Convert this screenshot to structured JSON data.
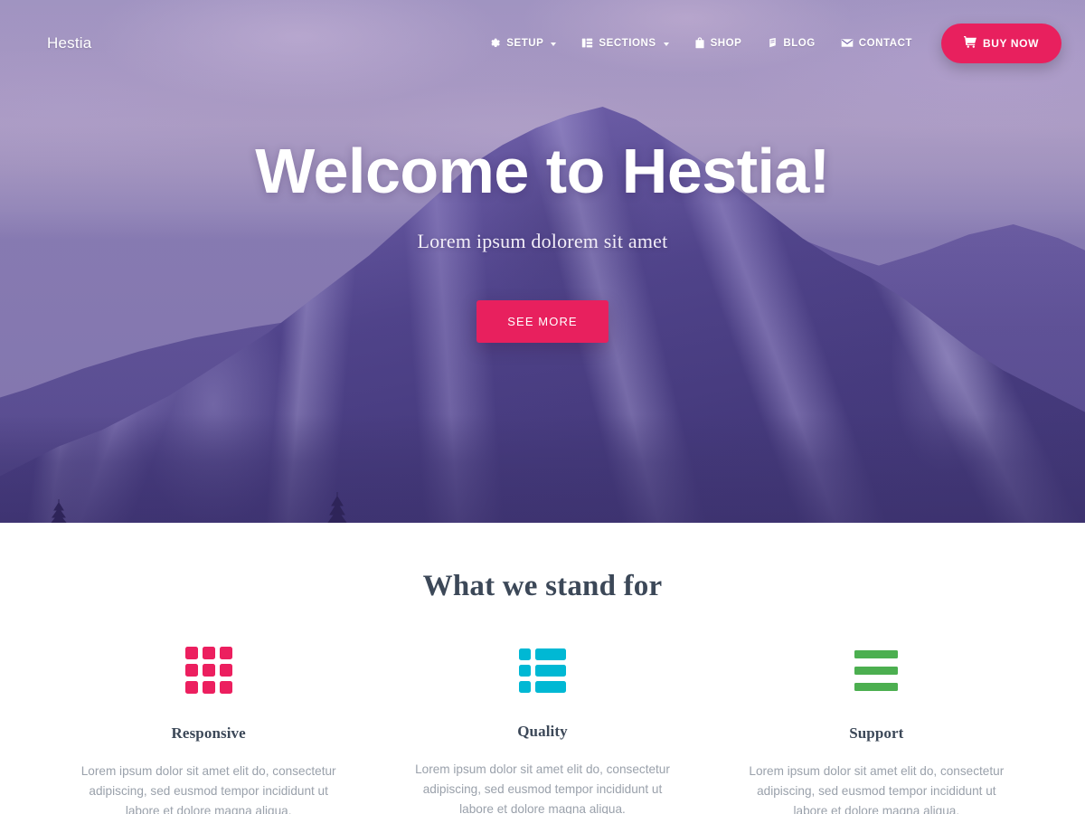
{
  "navbar": {
    "brand": "Hestia",
    "items": [
      {
        "label": "SETUP",
        "icon": "gear-icon",
        "has_caret": true
      },
      {
        "label": "SECTIONS",
        "icon": "sections-icon",
        "has_caret": true
      },
      {
        "label": "SHOP",
        "icon": "shopping-bag-icon",
        "has_caret": false
      },
      {
        "label": "BLOG",
        "icon": "pencil-icon",
        "has_caret": false
      },
      {
        "label": "CONTACT",
        "icon": "envelope-icon",
        "has_caret": false
      }
    ],
    "buy_now": {
      "label": "BUY NOW",
      "icon": "shopping-cart-icon"
    }
  },
  "hero": {
    "title": "Welcome to Hestia!",
    "subtitle": "Lorem ipsum dolorem sit amet",
    "cta_label": "SEE MORE"
  },
  "features": {
    "title": "What we stand for",
    "items": [
      {
        "icon": "grid-icon",
        "color": "#ec1f5f",
        "title": "Responsive",
        "text": "Lorem ipsum dolor sit amet elit do, consectetur adipiscing, sed eusmod tempor incididunt ut labore et dolore magna aliqua."
      },
      {
        "icon": "list-icon",
        "color": "#00b8d4",
        "title": "Quality",
        "text": "Lorem ipsum dolor sit amet elit do, consectetur adipiscing, sed eusmod tempor incididunt ut labore et dolore magna aliqua."
      },
      {
        "icon": "bars-icon",
        "color": "#4caf50",
        "title": "Support",
        "text": "Lorem ipsum dolor sit amet elit do, consectetur adipiscing, sed eusmod tempor incididunt ut labore et dolore magna aliqua."
      }
    ]
  },
  "colors": {
    "accent_pink": "#e8205e",
    "icon_pink": "#ec1f5f",
    "icon_cyan": "#00b8d4",
    "icon_green": "#4caf50",
    "heading_slate": "#3c4858",
    "body_gray": "#9aa1ab",
    "hero_purple": "#6f5fa8"
  }
}
